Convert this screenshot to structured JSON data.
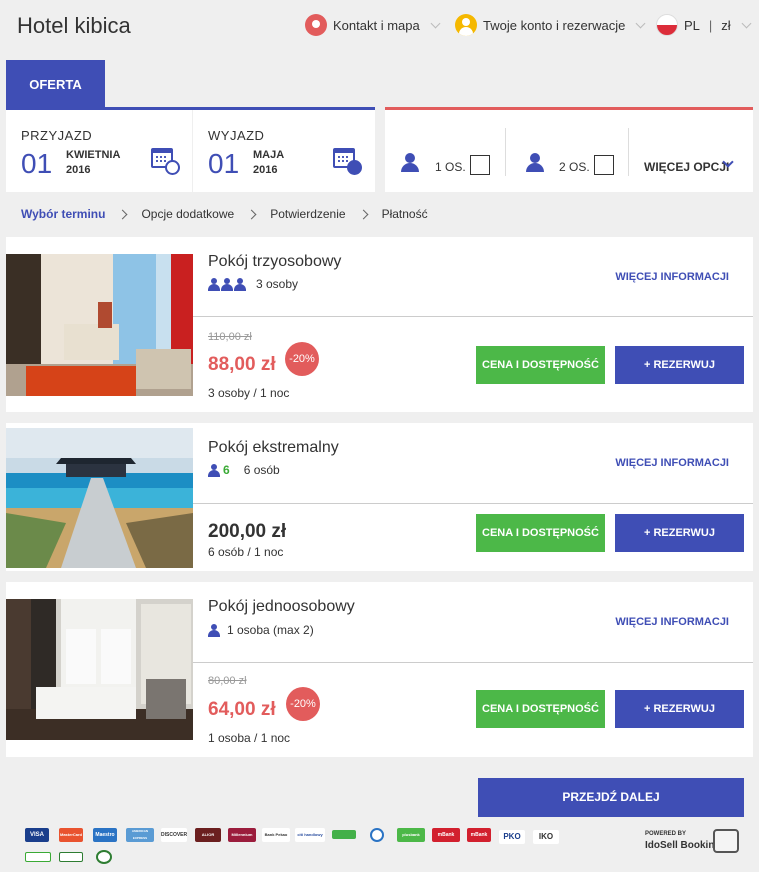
{
  "header": {
    "title": "Hotel kibica",
    "contact_label": "Kontakt i mapa",
    "account_label": "Twoje konto i rezerwacje",
    "language": "PL",
    "currency": "zł"
  },
  "tabs": {
    "offer_label": "OFERTA"
  },
  "dates": {
    "checkin": {
      "label": "PRZYJAZD",
      "day": "01",
      "month": "KWIETNIA",
      "year": "2016"
    },
    "checkout": {
      "label": "WYJAZD",
      "day": "01",
      "month": "MAJA",
      "year": "2016"
    }
  },
  "guests": {
    "option1_label": "1 OS.",
    "option2_label": "2 OS.",
    "more_options_label": "WIĘCEJ OPCJI"
  },
  "breadcrumb": {
    "step1": "Wybór terminu",
    "step2": "Opcje dodatkowe",
    "step3": "Potwierdzenie",
    "step4": "Płatność"
  },
  "rooms": [
    {
      "name": "Pokój trzyosobowy",
      "occupancy": "3 osoby",
      "more_info": "WIĘCEJ INFORMACJI",
      "old_price": "110,00 zł",
      "price": "88,00 zł",
      "discount": "-20%",
      "per_night": "3 osoby / 1 noc",
      "availability_label": "CENA I DOSTĘPNOŚĆ",
      "book_label": "+ REZERWUJ"
    },
    {
      "name": "Pokój ekstremalny",
      "occupancy_count": "6",
      "occupancy": "6 osób",
      "more_info": "WIĘCEJ INFORMACJI",
      "price": "200,00 zł",
      "per_night": "6 osób / 1 noc",
      "availability_label": "CENA I DOSTĘPNOŚĆ",
      "book_label": "+ REZERWUJ"
    },
    {
      "name": "Pokój jednoosobowy",
      "occupancy": "1 osoba (max 2)",
      "more_info": "WIĘCEJ INFORMACJI",
      "old_price": "80,00 zł",
      "price": "64,00 zł",
      "discount": "-20%",
      "per_night": "1 osoba / 1 noc",
      "availability_label": "CENA I DOSTĘPNOŚĆ",
      "book_label": "+ REZERWUJ"
    }
  ],
  "next_button": "PRZEJDŹ DALEJ",
  "footer": {
    "payment_logos": [
      "VISA",
      "MasterCard",
      "Maestro",
      "AMERICAN EXPRESS",
      "DISCOVER",
      "ALIOR",
      "Millennium",
      "Bank Pekao",
      "citi handlowy",
      "",
      "",
      "plusbank",
      "mBank",
      "mBank",
      "PKO",
      "IKO",
      "",
      "",
      ""
    ],
    "powered_by": "POWERED BY",
    "brand": "IdoSell Booking"
  },
  "colors": {
    "accent_blue": "#3f4eb5",
    "accent_red": "#e25c5c",
    "accent_green": "#4cb848",
    "background": "#efefef"
  }
}
